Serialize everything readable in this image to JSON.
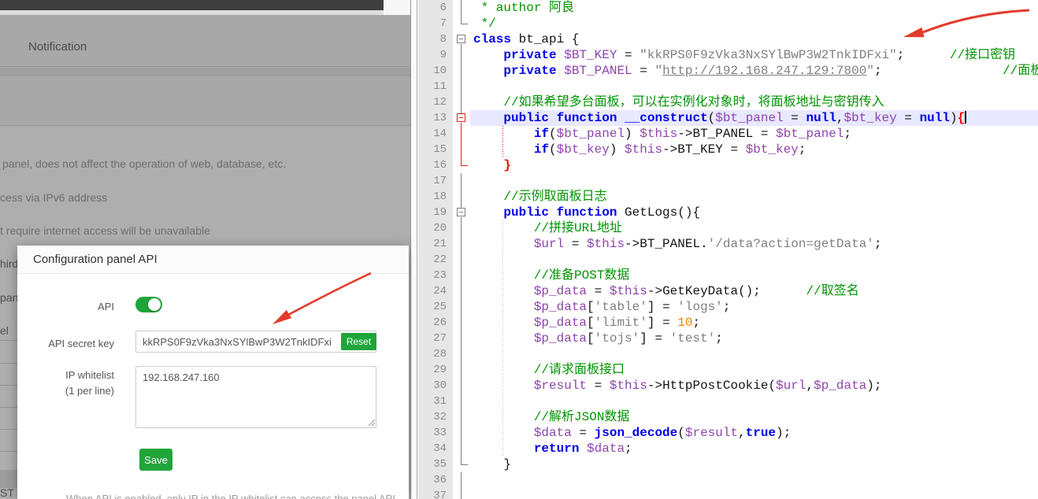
{
  "css_vars": {
    "--accent": "#20A53A",
    "--arrow": "#E23B2C",
    "--kw": "#0000E8",
    "--com": "#009500",
    "--str": "#808080",
    "--var": "#8E44AD",
    "--num": "#FF8000",
    "--brace": "#FF0000",
    "--hl": "#E8E8FF"
  },
  "background_page": {
    "section_title": "Notification",
    "sentences": [
      "panel, does not affect the operation of web, database, etc.",
      "cess via IPv6 address",
      "t require internet access will be unavailable"
    ],
    "fragments": [
      "hird-",
      "pan",
      "el",
      "ST -"
    ]
  },
  "modal": {
    "title": "Configuration panel API",
    "api_label": "API",
    "api_toggle_state": "on",
    "secret_key_label": "API secret key",
    "secret_key_value": "kkRPS0F9zVka3NxSYlBwP3W2TnkIDFxi",
    "reset_button": "Reset",
    "whitelist_label_line1": "IP whitelist",
    "whitelist_label_line2": "(1 per line)",
    "whitelist_value": "192.168.247.160",
    "save_button": "Save",
    "footnote": "When API is enabled, only IP in the IP whitelist can access the panel API"
  },
  "editor": {
    "lines": [
      {
        "n": 6,
        "f": "line",
        "g": "",
        "t": [
          [
            "c",
            " * author 阿良"
          ]
        ]
      },
      {
        "n": 7,
        "f": "end",
        "g": "",
        "t": [
          [
            "c",
            " */"
          ]
        ]
      },
      {
        "n": 8,
        "f": "box lb",
        "g": "",
        "t": [
          [
            "k",
            "class"
          ],
          [
            "p",
            " bt_api {"
          ]
        ]
      },
      {
        "n": 9,
        "f": "line",
        "g": "",
        "t": [
          [
            "p",
            "    "
          ],
          [
            "k",
            "private"
          ],
          [
            "p",
            " "
          ],
          [
            "v",
            "$BT_KEY"
          ],
          [
            "p",
            " = "
          ],
          [
            "s",
            "\"kkRPS0F9zVka3NxSYlBwP3W2TnkIDFxi\""
          ],
          [
            "p",
            ";      "
          ],
          [
            "c",
            "//接口密钥"
          ]
        ]
      },
      {
        "n": 10,
        "f": "line",
        "g": "",
        "t": [
          [
            "p",
            "    "
          ],
          [
            "k",
            "private"
          ],
          [
            "p",
            " "
          ],
          [
            "v",
            "$BT_PANEL"
          ],
          [
            "p",
            " = "
          ],
          [
            "s",
            "\""
          ],
          [
            "su",
            "http://192.168.247.129:7800"
          ],
          [
            "s",
            "\""
          ],
          [
            "p",
            ";                "
          ],
          [
            "c",
            "//面板地址"
          ]
        ]
      },
      {
        "n": 11,
        "f": "line",
        "g": "",
        "t": []
      },
      {
        "n": 12,
        "f": "line",
        "g": "",
        "t": [
          [
            "p",
            "    "
          ],
          [
            "c",
            "//如果希望多台面板，可以在实例化对象时，将面板地址与密钥传入"
          ]
        ]
      },
      {
        "n": 13,
        "f": "la lbred box boxred",
        "g": "",
        "hl": true,
        "t": [
          [
            "p",
            "    "
          ],
          [
            "k",
            "public"
          ],
          [
            "p",
            " "
          ],
          [
            "k",
            "function"
          ],
          [
            "p",
            " "
          ],
          [
            "k",
            "__construct"
          ],
          [
            "p",
            "("
          ],
          [
            "v",
            "$bt_panel"
          ],
          [
            "p",
            " = "
          ],
          [
            "k",
            "null"
          ],
          [
            "p",
            ","
          ],
          [
            "v",
            "$bt_key"
          ],
          [
            "p",
            " = "
          ],
          [
            "k",
            "null"
          ],
          [
            "p",
            ")"
          ],
          [
            "b",
            "{"
          ],
          [
            "caret",
            ""
          ]
        ]
      },
      {
        "n": 14,
        "f": "linered",
        "g": "r",
        "t": [
          [
            "p",
            "        "
          ],
          [
            "k",
            "if"
          ],
          [
            "p",
            "("
          ],
          [
            "v",
            "$bt_panel"
          ],
          [
            "p",
            ") "
          ],
          [
            "v",
            "$this"
          ],
          [
            "p",
            "->BT_PANEL = "
          ],
          [
            "v",
            "$bt_panel"
          ],
          [
            "p",
            ";"
          ]
        ]
      },
      {
        "n": 15,
        "f": "linered",
        "g": "r",
        "t": [
          [
            "p",
            "        "
          ],
          [
            "k",
            "if"
          ],
          [
            "p",
            "("
          ],
          [
            "v",
            "$bt_key"
          ],
          [
            "p",
            ") "
          ],
          [
            "v",
            "$this"
          ],
          [
            "p",
            "->BT_KEY = "
          ],
          [
            "v",
            "$bt_key"
          ],
          [
            "p",
            ";"
          ]
        ]
      },
      {
        "n": 16,
        "f": "endred",
        "g": "",
        "t": [
          [
            "p",
            "    "
          ],
          [
            "b",
            "}"
          ]
        ]
      },
      {
        "n": 17,
        "f": "line",
        "g": "",
        "t": []
      },
      {
        "n": 18,
        "f": "line",
        "g": "",
        "t": [
          [
            "p",
            "    "
          ],
          [
            "c",
            "//示例取面板日志"
          ]
        ]
      },
      {
        "n": 19,
        "f": "box la lb",
        "g": "",
        "t": [
          [
            "p",
            "    "
          ],
          [
            "k",
            "public"
          ],
          [
            "p",
            " "
          ],
          [
            "k",
            "function"
          ],
          [
            "p",
            " GetLogs(){"
          ]
        ]
      },
      {
        "n": 20,
        "f": "line",
        "g": "g",
        "t": [
          [
            "p",
            "        "
          ],
          [
            "c",
            "//拼接URL地址"
          ]
        ]
      },
      {
        "n": 21,
        "f": "line",
        "g": "g",
        "t": [
          [
            "p",
            "        "
          ],
          [
            "v",
            "$url"
          ],
          [
            "p",
            " = "
          ],
          [
            "v",
            "$this"
          ],
          [
            "p",
            "->BT_PANEL."
          ],
          [
            "s",
            "'/data?action=getData'"
          ],
          [
            "p",
            ";"
          ]
        ]
      },
      {
        "n": 22,
        "f": "line",
        "g": "g",
        "t": []
      },
      {
        "n": 23,
        "f": "line",
        "g": "g",
        "t": [
          [
            "p",
            "        "
          ],
          [
            "c",
            "//准备POST数据"
          ]
        ]
      },
      {
        "n": 24,
        "f": "line",
        "g": "g",
        "t": [
          [
            "p",
            "        "
          ],
          [
            "v",
            "$p_data"
          ],
          [
            "p",
            " = "
          ],
          [
            "v",
            "$this"
          ],
          [
            "p",
            "->GetKeyData();      "
          ],
          [
            "c",
            "//取签名"
          ]
        ]
      },
      {
        "n": 25,
        "f": "line",
        "g": "g",
        "t": [
          [
            "p",
            "        "
          ],
          [
            "v",
            "$p_data"
          ],
          [
            "p",
            "["
          ],
          [
            "s",
            "'table'"
          ],
          [
            "p",
            "] = "
          ],
          [
            "s",
            "'logs'"
          ],
          [
            "p",
            ";"
          ]
        ]
      },
      {
        "n": 26,
        "f": "line",
        "g": "g",
        "t": [
          [
            "p",
            "        "
          ],
          [
            "v",
            "$p_data"
          ],
          [
            "p",
            "["
          ],
          [
            "s",
            "'limit'"
          ],
          [
            "p",
            "] = "
          ],
          [
            "n",
            "10"
          ],
          [
            "p",
            ";"
          ]
        ]
      },
      {
        "n": 27,
        "f": "line",
        "g": "g",
        "t": [
          [
            "p",
            "        "
          ],
          [
            "v",
            "$p_data"
          ],
          [
            "p",
            "["
          ],
          [
            "s",
            "'tojs'"
          ],
          [
            "p",
            "] = "
          ],
          [
            "s",
            "'test'"
          ],
          [
            "p",
            ";"
          ]
        ]
      },
      {
        "n": 28,
        "f": "line",
        "g": "g",
        "t": []
      },
      {
        "n": 29,
        "f": "line",
        "g": "g",
        "t": [
          [
            "p",
            "        "
          ],
          [
            "c",
            "//请求面板接口"
          ]
        ]
      },
      {
        "n": 30,
        "f": "line",
        "g": "g",
        "t": [
          [
            "p",
            "        "
          ],
          [
            "v",
            "$result"
          ],
          [
            "p",
            " = "
          ],
          [
            "v",
            "$this"
          ],
          [
            "p",
            "->HttpPostCookie("
          ],
          [
            "v",
            "$url"
          ],
          [
            "p",
            ","
          ],
          [
            "v",
            "$p_data"
          ],
          [
            "p",
            ");"
          ]
        ]
      },
      {
        "n": 31,
        "f": "line",
        "g": "g",
        "t": []
      },
      {
        "n": 32,
        "f": "line",
        "g": "g",
        "t": [
          [
            "p",
            "        "
          ],
          [
            "c",
            "//解析JSON数据"
          ]
        ]
      },
      {
        "n": 33,
        "f": "line",
        "g": "g",
        "t": [
          [
            "p",
            "        "
          ],
          [
            "v",
            "$data"
          ],
          [
            "p",
            " = "
          ],
          [
            "k",
            "json_decode"
          ],
          [
            "p",
            "("
          ],
          [
            "v",
            "$result"
          ],
          [
            "p",
            ","
          ],
          [
            "k",
            "true"
          ],
          [
            "p",
            ");"
          ]
        ]
      },
      {
        "n": 34,
        "f": "line",
        "g": "g",
        "t": [
          [
            "p",
            "        "
          ],
          [
            "k",
            "return"
          ],
          [
            "p",
            " "
          ],
          [
            "v",
            "$data"
          ],
          [
            "p",
            ";"
          ]
        ]
      },
      {
        "n": 35,
        "f": "end",
        "g": "",
        "t": [
          [
            "p",
            "    }"
          ]
        ]
      },
      {
        "n": 36,
        "f": "line",
        "g": "",
        "t": []
      },
      {
        "n": 37,
        "f": "line",
        "g": "",
        "t": []
      }
    ]
  }
}
